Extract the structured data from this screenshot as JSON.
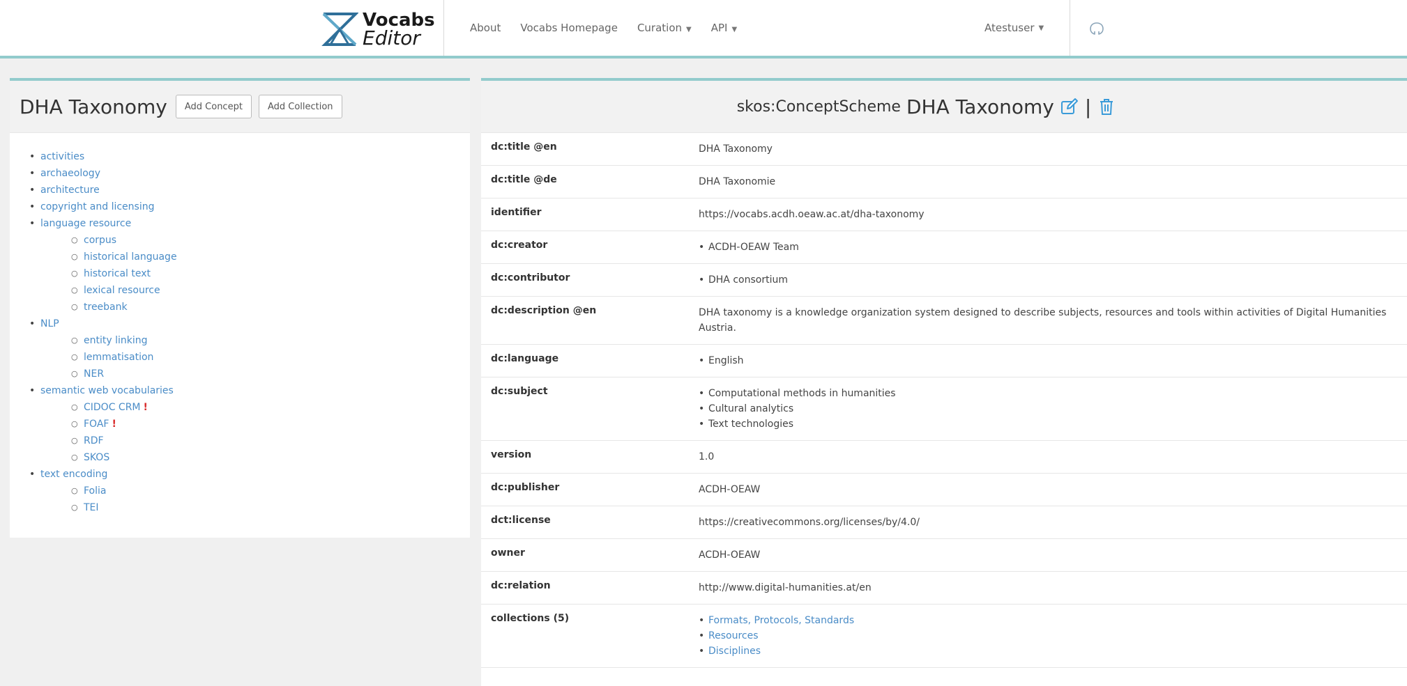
{
  "brand": {
    "line1": "Vocabs",
    "line2": "Editor"
  },
  "nav": {
    "about": "About",
    "homepage": "Vocabs Homepage",
    "curation": "Curation",
    "api": "API",
    "user": "Atestuser"
  },
  "left": {
    "title": "DHA Taxonomy",
    "add_concept": "Add Concept",
    "add_collection": "Add Collection",
    "tree": [
      {
        "label": "activities",
        "children": []
      },
      {
        "label": "archaeology",
        "children": []
      },
      {
        "label": "architecture",
        "children": []
      },
      {
        "label": "copyright and licensing",
        "children": []
      },
      {
        "label": "language resource",
        "children": [
          {
            "label": "corpus"
          },
          {
            "label": "historical language"
          },
          {
            "label": "historical text"
          },
          {
            "label": "lexical resource"
          },
          {
            "label": "treebank"
          }
        ]
      },
      {
        "label": "NLP",
        "children": [
          {
            "label": "entity linking"
          },
          {
            "label": "lemmatisation"
          },
          {
            "label": "NER"
          }
        ]
      },
      {
        "label": "semantic web vocabularies",
        "children": [
          {
            "label": "CIDOC CRM",
            "warn": "!"
          },
          {
            "label": "FOAF",
            "warn": "!"
          },
          {
            "label": "RDF"
          },
          {
            "label": "SKOS"
          }
        ]
      },
      {
        "label": "text encoding",
        "children": [
          {
            "label": "Folia"
          },
          {
            "label": "TEI"
          }
        ]
      }
    ]
  },
  "right": {
    "prefix": "skos:ConceptScheme",
    "title": "DHA Taxonomy",
    "separator": "|",
    "properties": [
      {
        "key": "dc:title @en",
        "value": "DHA Taxonomy"
      },
      {
        "key": "dc:title @de",
        "value": "DHA Taxonomie"
      },
      {
        "key": "identifier",
        "value": "https://vocabs.acdh.oeaw.ac.at/dha-taxonomy"
      },
      {
        "key": "dc:creator",
        "list": [
          "ACDH-OEAW Team"
        ]
      },
      {
        "key": "dc:contributor",
        "list": [
          "DHA consortium"
        ]
      },
      {
        "key": "dc:description @en",
        "value": "DHA taxonomy is a knowledge organization system designed to describe subjects, resources and tools within activities of Digital Humanities Austria."
      },
      {
        "key": "dc:language",
        "list": [
          "English"
        ]
      },
      {
        "key": "dc:subject",
        "list": [
          "Computational methods in humanities",
          "Cultural analytics",
          "Text technologies"
        ]
      },
      {
        "key": "version",
        "value": "1.0"
      },
      {
        "key": "dc:publisher",
        "value": "ACDH-OEAW"
      },
      {
        "key": "dct:license",
        "value": "https://creativecommons.org/licenses/by/4.0/"
      },
      {
        "key": "owner",
        "value": "ACDH-OEAW"
      },
      {
        "key": "dc:relation",
        "value": "http://www.digital-humanities.at/en"
      },
      {
        "key": "collections (5)",
        "links": [
          "Formats, Protocols, Standards",
          "Resources",
          "Disciplines"
        ]
      }
    ]
  }
}
